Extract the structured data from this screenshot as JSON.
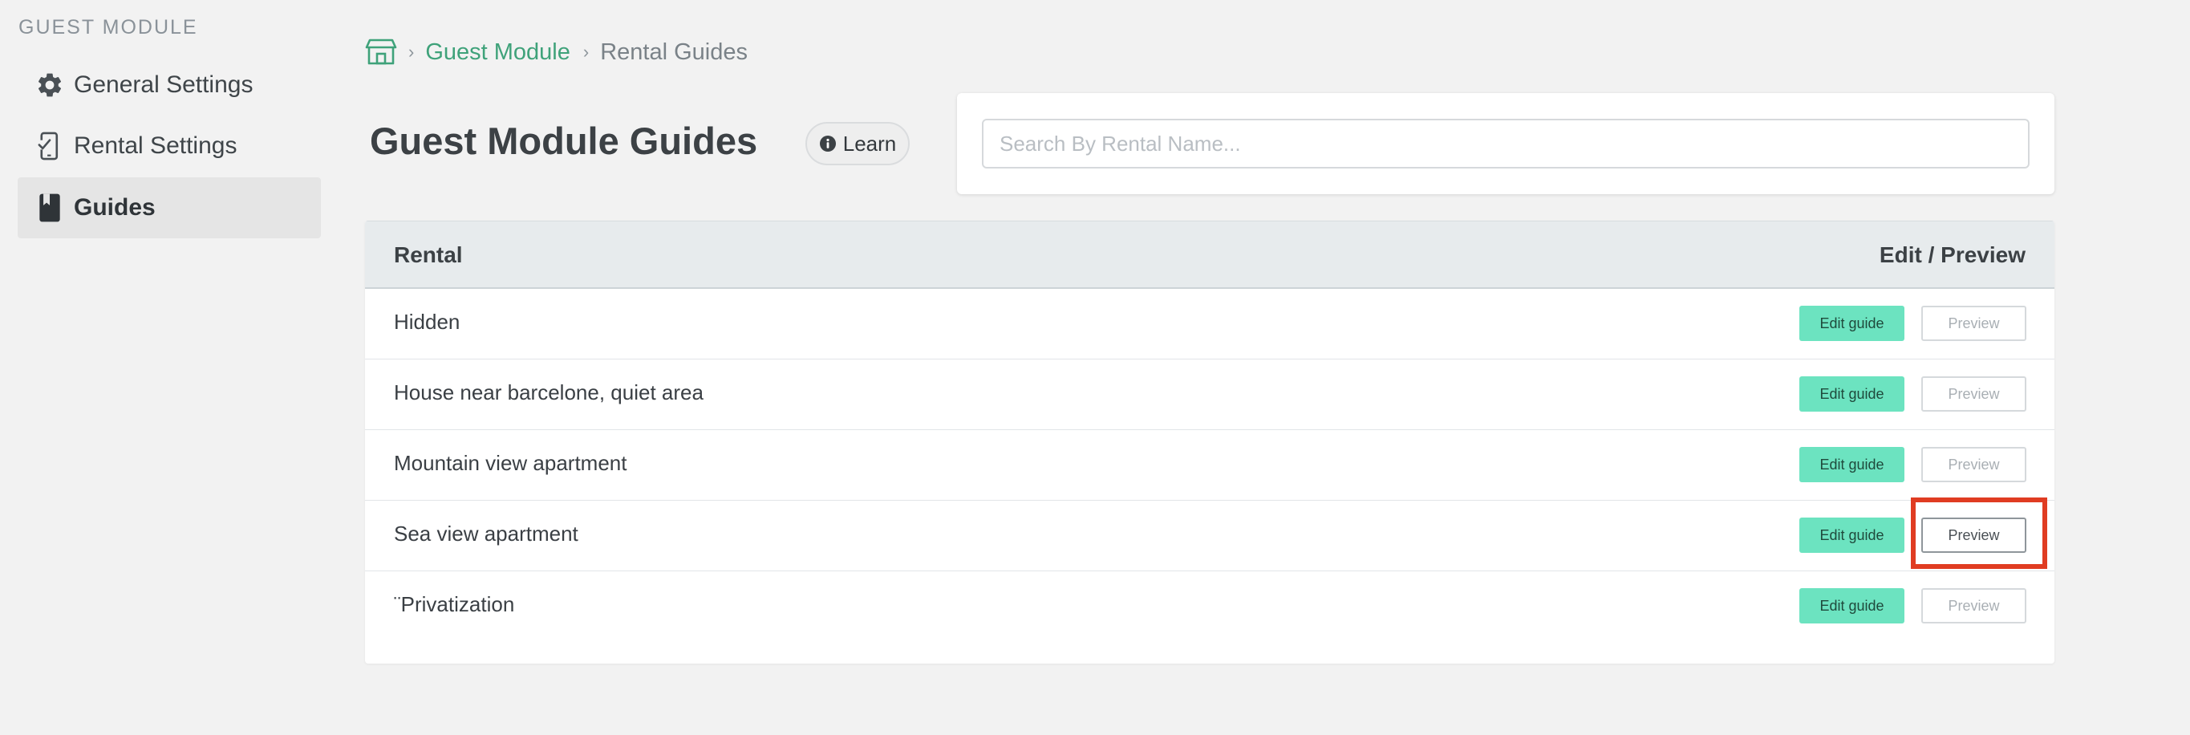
{
  "sidebar": {
    "heading": "GUEST MODULE",
    "items": [
      {
        "label": "General Settings",
        "icon": "gear-icon",
        "active": false
      },
      {
        "label": "Rental Settings",
        "icon": "phone-check-icon",
        "active": false
      },
      {
        "label": "Guides",
        "icon": "book-icon",
        "active": true
      }
    ]
  },
  "breadcrumb": {
    "home_icon": "store-icon",
    "separator": "›",
    "link": "Guest Module",
    "current": "Rental Guides"
  },
  "page": {
    "title": "Guest Module Guides",
    "learn_label": "Learn",
    "learn_icon": "info-icon"
  },
  "search": {
    "placeholder": "Search By Rental Name...",
    "value": ""
  },
  "table": {
    "headers": {
      "rental": "Rental",
      "actions": "Edit / Preview"
    },
    "edit_label": "Edit guide",
    "preview_label": "Preview",
    "rows": [
      {
        "name": "Hidden"
      },
      {
        "name": "House near barcelone, quiet area"
      },
      {
        "name": "Mountain view apartment"
      },
      {
        "name": "Sea view apartment"
      },
      {
        "name": "¨Privatization"
      }
    ]
  },
  "colors": {
    "accent": "#3fa27a",
    "edit_button": "#6ce3c0",
    "highlight": "#e03c22",
    "background": "#f2f2f2"
  }
}
